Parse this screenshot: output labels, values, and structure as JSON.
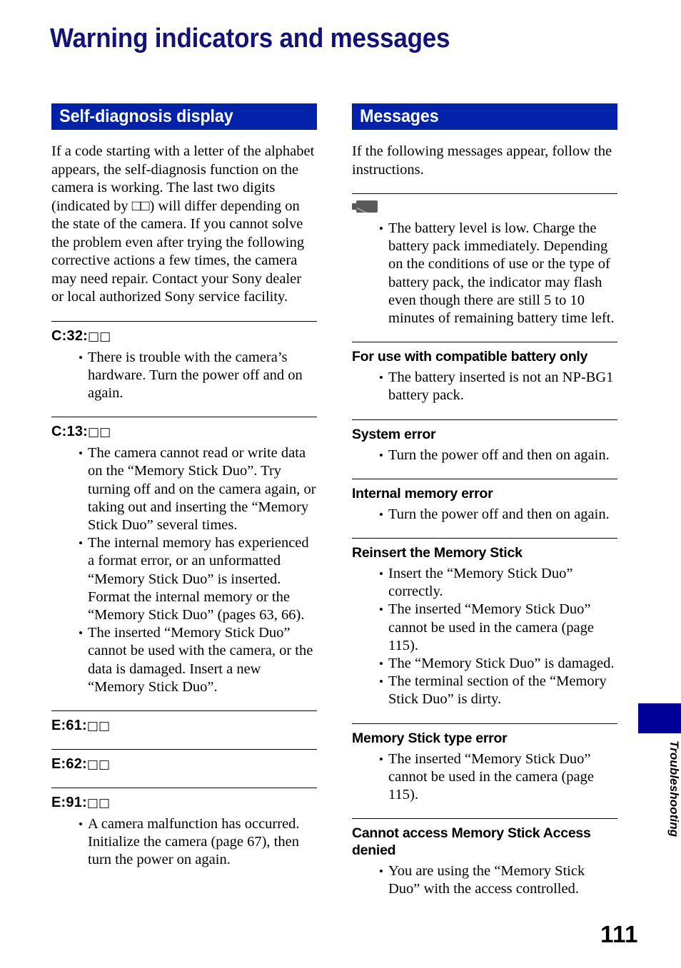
{
  "page": {
    "title": "Warning indicators and messages",
    "number": "111",
    "side_tab_label": "Troubleshooting",
    "accent_blue": "#0022A8",
    "title_color": "#121277",
    "tab_navy": "#000099"
  },
  "left_column": {
    "header": "Self-diagnosis display",
    "intro": "If a code starting with a letter of the alphabet appears, the self-diagnosis function on the camera is working. The last two digits (indicated by □□) will differ depending on the state of the camera. If you cannot solve the problem even after trying the following corrective actions a few times, the camera may need repair. Contact your Sony dealer or local authorized Sony service facility.",
    "entries": [
      {
        "title": "C:32:□□",
        "bullets": [
          "There is trouble with the camera’s hardware. Turn the power off and on again."
        ]
      },
      {
        "title": "C:13:□□",
        "bullets": [
          "The camera cannot read or write data on the “Memory Stick Duo”. Try turning off and on the camera again, or taking out and inserting the “Memory Stick Duo” several times.",
          "The internal memory has experienced a format error, or an unformatted “Memory Stick Duo” is inserted. Format the internal memory or the “Memory Stick Duo” (pages 63, 66).",
          "The inserted “Memory Stick Duo” cannot be used with the camera, or the data is damaged. Insert a new “Memory Stick Duo”."
        ]
      },
      {
        "title": "E:61:□□",
        "bullets": []
      },
      {
        "title": "E:62:□□",
        "bullets": []
      },
      {
        "title": "E:91:□□",
        "bullets": [
          "A camera malfunction has occurred. Initialize the camera (page 67), then turn the power on again."
        ]
      }
    ]
  },
  "right_column": {
    "header": "Messages",
    "intro": "If the following messages appear, follow the instructions.",
    "entries": [
      {
        "title": "",
        "icon": "low-battery-icon",
        "bullets": [
          "The battery level is low. Charge the battery pack immediately. Depending on the conditions of use or the type of battery pack, the indicator may flash even though there are still 5 to 10 minutes of remaining battery time left."
        ]
      },
      {
        "title": "For use with compatible battery only",
        "bullets": [
          "The battery inserted is not an NP-BG1 battery pack."
        ]
      },
      {
        "title": "System error",
        "bullets": [
          "Turn the power off and then on again."
        ]
      },
      {
        "title": "Internal memory error",
        "bullets": [
          "Turn the power off and then on again."
        ]
      },
      {
        "title": "Reinsert the Memory Stick",
        "bullets": [
          "Insert the “Memory Stick Duo” correctly.",
          "The inserted “Memory Stick Duo” cannot be used in the camera (page 115).",
          "The “Memory Stick Duo” is damaged.",
          "The terminal section of the “Memory Stick Duo” is dirty."
        ]
      },
      {
        "title": "Memory Stick type error",
        "bullets": [
          "The inserted “Memory Stick Duo” cannot be used in the camera (page 115)."
        ]
      },
      {
        "title": "Cannot access Memory Stick Access denied",
        "bullets": [
          "You are using the “Memory Stick Duo” with the access controlled."
        ]
      }
    ]
  }
}
